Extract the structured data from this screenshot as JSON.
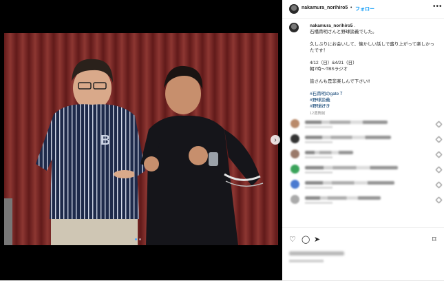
{
  "post": {
    "username": "nakamura_norihiro5",
    "separator": "•",
    "follow_label": "フォロー",
    "more_label": "•••"
  },
  "caption": {
    "username": "nakamura_norihiro5",
    "suffix": ".",
    "line1": "石橋貴明さんと野球談義でした。",
    "line2": "久しぶりにお会いして、懐かしい話しで盛り上がって楽しかっ",
    "line3": "たです！",
    "line4": "4/12（日）&4/21（日）",
    "line5": "朝7時〜TBSラジオ",
    "line6": "皆さんも是非楽しんで下さい‼",
    "hashtags": [
      "#石貴明のgate７",
      "#野球談義",
      "#野球好き"
    ],
    "ago": "12週間前"
  },
  "icons": {
    "next": "chevron-right-icon",
    "like": "heart-icon",
    "comment": "comment-icon",
    "share": "share-icon",
    "save": "bookmark-icon"
  },
  "colors": {
    "link": "#0095f6",
    "hashtag": "#00376b",
    "curtain": "#8a2a2a"
  }
}
